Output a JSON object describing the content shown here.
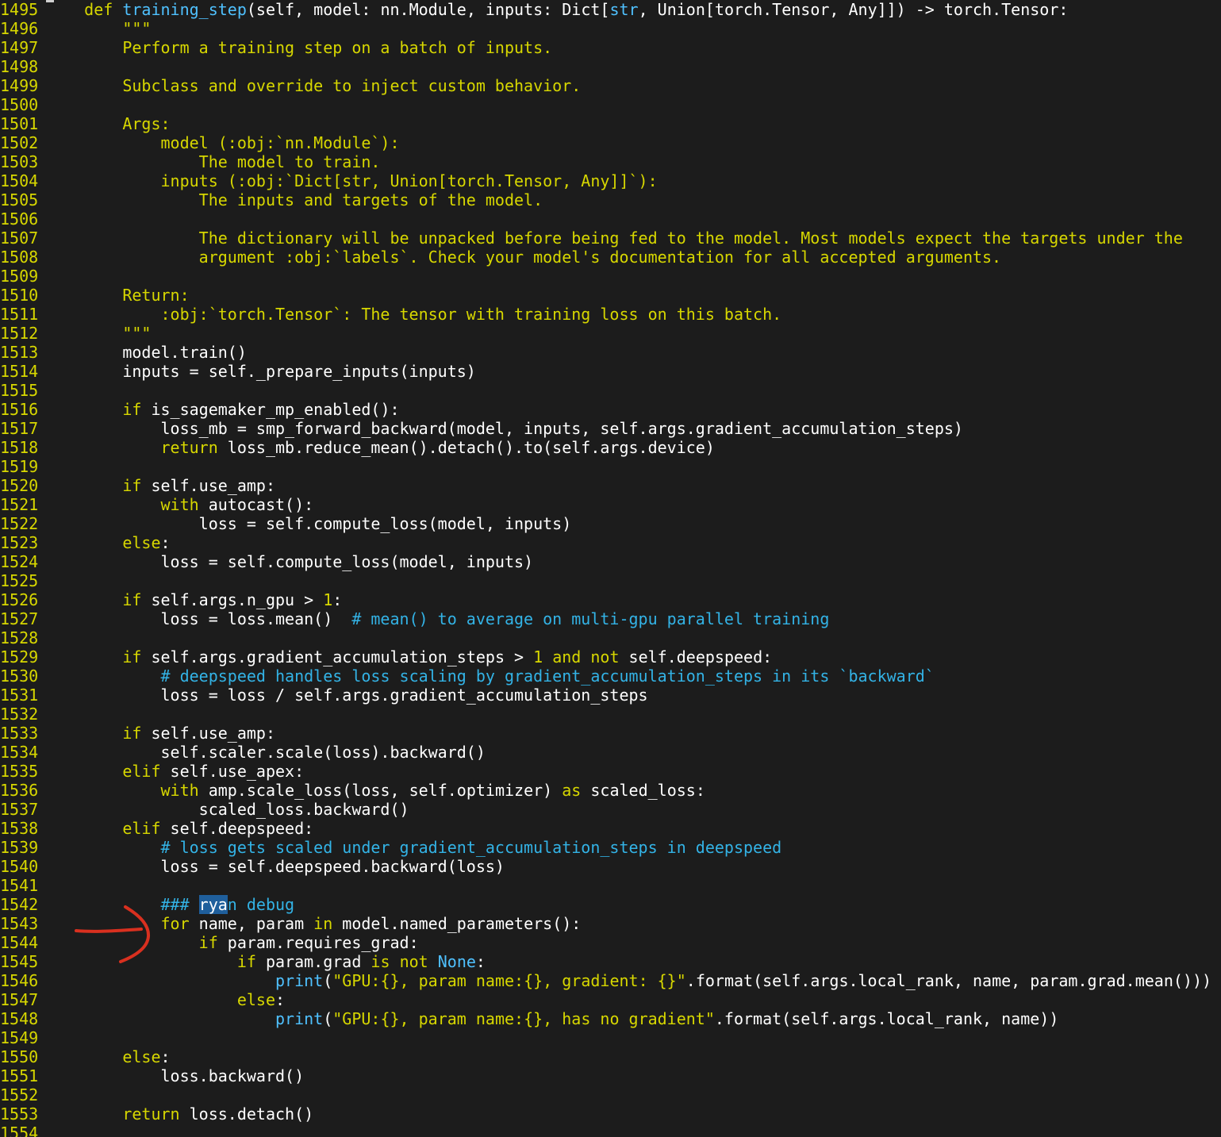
{
  "editor": {
    "lines": [
      {
        "n": "1495",
        "t": [
          [
            "    ",
            ""
          ],
          [
            "def",
            "kw"
          ],
          [
            " ",
            ""
          ],
          [
            "training_step",
            "fn"
          ],
          [
            "(self, model: nn.Module, inputs: Dict[",
            ""
          ],
          [
            "str",
            "bi"
          ],
          [
            ", Union[torch.Tensor, Any]]) -> torch.Tensor:",
            ""
          ]
        ]
      },
      {
        "n": "1496",
        "t": [
          [
            "        \"\"\"",
            "doc"
          ]
        ]
      },
      {
        "n": "1497",
        "t": [
          [
            "        Perform a training step on a batch of inputs.",
            "doc"
          ]
        ]
      },
      {
        "n": "1498",
        "t": [
          [
            "",
            ""
          ]
        ]
      },
      {
        "n": "1499",
        "t": [
          [
            "        Subclass and override to inject custom behavior.",
            "doc"
          ]
        ]
      },
      {
        "n": "1500",
        "t": [
          [
            "",
            ""
          ]
        ]
      },
      {
        "n": "1501",
        "t": [
          [
            "        Args:",
            "doc"
          ]
        ]
      },
      {
        "n": "1502",
        "t": [
          [
            "            model (:obj:`nn.Module`):",
            "doc"
          ]
        ]
      },
      {
        "n": "1503",
        "t": [
          [
            "                The model to train.",
            "doc"
          ]
        ]
      },
      {
        "n": "1504",
        "t": [
          [
            "            inputs (:obj:`Dict[str, Union[torch.Tensor, Any]]`):",
            "doc"
          ]
        ]
      },
      {
        "n": "1505",
        "t": [
          [
            "                The inputs and targets of the model.",
            "doc"
          ]
        ]
      },
      {
        "n": "1506",
        "t": [
          [
            "",
            ""
          ]
        ]
      },
      {
        "n": "1507",
        "t": [
          [
            "                The dictionary will be unpacked before being fed to the model. Most models expect the targets under the",
            "doc"
          ]
        ]
      },
      {
        "n": "1508",
        "t": [
          [
            "                argument :obj:`labels`. Check your model's documentation for all accepted arguments.",
            "doc"
          ]
        ]
      },
      {
        "n": "1509",
        "t": [
          [
            "",
            ""
          ]
        ]
      },
      {
        "n": "1510",
        "t": [
          [
            "        Return:",
            "doc"
          ]
        ]
      },
      {
        "n": "1511",
        "t": [
          [
            "            :obj:`torch.Tensor`: The tensor with training loss on this batch.",
            "doc"
          ]
        ]
      },
      {
        "n": "1512",
        "t": [
          [
            "        \"\"\"",
            "doc"
          ]
        ]
      },
      {
        "n": "1513",
        "t": [
          [
            "        model.train()",
            ""
          ]
        ]
      },
      {
        "n": "1514",
        "t": [
          [
            "        inputs = self._prepare_inputs(inputs)",
            ""
          ]
        ]
      },
      {
        "n": "1515",
        "t": [
          [
            "",
            ""
          ]
        ]
      },
      {
        "n": "1516",
        "t": [
          [
            "        ",
            ""
          ],
          [
            "if",
            "kw"
          ],
          [
            " is_sagemaker_mp_enabled():",
            ""
          ]
        ]
      },
      {
        "n": "1517",
        "t": [
          [
            "            loss_mb = smp_forward_backward(model, inputs, self.args.gradient_accumulation_steps)",
            ""
          ]
        ]
      },
      {
        "n": "1518",
        "t": [
          [
            "            ",
            ""
          ],
          [
            "return",
            "kw"
          ],
          [
            " loss_mb.reduce_mean().detach().to(self.args.device)",
            ""
          ]
        ]
      },
      {
        "n": "1519",
        "t": [
          [
            "",
            ""
          ]
        ]
      },
      {
        "n": "1520",
        "t": [
          [
            "        ",
            ""
          ],
          [
            "if",
            "kw"
          ],
          [
            " self.use_amp:",
            ""
          ]
        ]
      },
      {
        "n": "1521",
        "t": [
          [
            "            ",
            ""
          ],
          [
            "with",
            "kw"
          ],
          [
            " autocast():",
            ""
          ]
        ]
      },
      {
        "n": "1522",
        "t": [
          [
            "                loss = self.compute_loss(model, inputs)",
            ""
          ]
        ]
      },
      {
        "n": "1523",
        "t": [
          [
            "        ",
            ""
          ],
          [
            "else",
            "kw"
          ],
          [
            ":",
            ""
          ]
        ]
      },
      {
        "n": "1524",
        "t": [
          [
            "            loss = self.compute_loss(model, inputs)",
            ""
          ]
        ]
      },
      {
        "n": "1525",
        "t": [
          [
            "",
            ""
          ]
        ]
      },
      {
        "n": "1526",
        "t": [
          [
            "        ",
            ""
          ],
          [
            "if",
            "kw"
          ],
          [
            " self.args.n_gpu > ",
            ""
          ],
          [
            "1",
            "num"
          ],
          [
            ":",
            ""
          ]
        ]
      },
      {
        "n": "1527",
        "t": [
          [
            "            loss = loss.mean()  ",
            ""
          ],
          [
            "# mean() to average on multi-gpu parallel training",
            "cm"
          ]
        ]
      },
      {
        "n": "1528",
        "t": [
          [
            "",
            ""
          ]
        ]
      },
      {
        "n": "1529",
        "t": [
          [
            "        ",
            ""
          ],
          [
            "if",
            "kw"
          ],
          [
            " self.args.gradient_accumulation_steps > ",
            ""
          ],
          [
            "1",
            "num"
          ],
          [
            " ",
            ""
          ],
          [
            "and",
            "kw"
          ],
          [
            " ",
            ""
          ],
          [
            "not",
            "kw"
          ],
          [
            " self.deepspeed:",
            ""
          ]
        ]
      },
      {
        "n": "1530",
        "t": [
          [
            "            ",
            ""
          ],
          [
            "# deepspeed handles loss scaling by gradient_accumulation_steps in its `backward`",
            "cm"
          ]
        ]
      },
      {
        "n": "1531",
        "t": [
          [
            "            loss = loss / self.args.gradient_accumulation_steps",
            ""
          ]
        ]
      },
      {
        "n": "1532",
        "t": [
          [
            "",
            ""
          ]
        ]
      },
      {
        "n": "1533",
        "t": [
          [
            "        ",
            ""
          ],
          [
            "if",
            "kw"
          ],
          [
            " self.use_amp:",
            ""
          ]
        ]
      },
      {
        "n": "1534",
        "t": [
          [
            "            self.scaler.scale(loss).backward()",
            ""
          ]
        ]
      },
      {
        "n": "1535",
        "t": [
          [
            "        ",
            ""
          ],
          [
            "elif",
            "kw"
          ],
          [
            " self.use_apex:",
            ""
          ]
        ]
      },
      {
        "n": "1536",
        "t": [
          [
            "            ",
            ""
          ],
          [
            "with",
            "kw"
          ],
          [
            " amp.scale_loss(loss, self.optimizer) ",
            ""
          ],
          [
            "as",
            "kw"
          ],
          [
            " scaled_loss:",
            ""
          ]
        ]
      },
      {
        "n": "1537",
        "t": [
          [
            "                scaled_loss.backward()",
            ""
          ]
        ]
      },
      {
        "n": "1538",
        "t": [
          [
            "        ",
            ""
          ],
          [
            "elif",
            "kw"
          ],
          [
            " self.deepspeed:",
            ""
          ]
        ]
      },
      {
        "n": "1539",
        "t": [
          [
            "            ",
            ""
          ],
          [
            "# loss gets scaled under gradient_accumulation_steps in deepspeed",
            "cm"
          ]
        ]
      },
      {
        "n": "1540",
        "t": [
          [
            "            loss = self.deepspeed.backward(loss)",
            ""
          ]
        ]
      },
      {
        "n": "1541",
        "t": [
          [
            "",
            ""
          ]
        ]
      },
      {
        "n": "1542",
        "t": [
          [
            "            ",
            ""
          ],
          [
            "### ",
            "cm"
          ],
          [
            "rya",
            "hl"
          ],
          [
            "n debug",
            "cm"
          ]
        ]
      },
      {
        "n": "1543",
        "t": [
          [
            "            ",
            ""
          ],
          [
            "for",
            "kw"
          ],
          [
            " name, param ",
            ""
          ],
          [
            "in",
            "kw"
          ],
          [
            " model.named_parameters():",
            ""
          ]
        ]
      },
      {
        "n": "1544",
        "t": [
          [
            "                ",
            ""
          ],
          [
            "if",
            "kw"
          ],
          [
            " param.requires_grad:",
            ""
          ]
        ]
      },
      {
        "n": "1545",
        "t": [
          [
            "                    ",
            ""
          ],
          [
            "if",
            "kw"
          ],
          [
            " param.grad ",
            ""
          ],
          [
            "is",
            "kw"
          ],
          [
            " ",
            ""
          ],
          [
            "not",
            "kw"
          ],
          [
            " ",
            ""
          ],
          [
            "None",
            "bi"
          ],
          [
            ":",
            ""
          ]
        ]
      },
      {
        "n": "1546",
        "t": [
          [
            "                        ",
            ""
          ],
          [
            "print",
            "bi"
          ],
          [
            "(",
            ""
          ],
          [
            "\"GPU:{}, param name:{}, gradient: {}\"",
            "str"
          ],
          [
            ".format(self.args.local_rank, name, param.grad.mean()))",
            ""
          ]
        ]
      },
      {
        "n": "1547",
        "t": [
          [
            "                    ",
            ""
          ],
          [
            "else",
            "kw"
          ],
          [
            ":",
            ""
          ]
        ]
      },
      {
        "n": "1548",
        "t": [
          [
            "                        ",
            ""
          ],
          [
            "print",
            "bi"
          ],
          [
            "(",
            ""
          ],
          [
            "\"GPU:{}, param name:{}, has no gradient\"",
            "str"
          ],
          [
            ".format(self.args.local_rank, name))",
            ""
          ]
        ]
      },
      {
        "n": "1549",
        "t": [
          [
            "",
            ""
          ]
        ]
      },
      {
        "n": "1550",
        "t": [
          [
            "        ",
            ""
          ],
          [
            "else",
            "kw"
          ],
          [
            ":",
            ""
          ]
        ]
      },
      {
        "n": "1551",
        "t": [
          [
            "            loss.backward()",
            ""
          ]
        ]
      },
      {
        "n": "1552",
        "t": [
          [
            "",
            ""
          ]
        ]
      },
      {
        "n": "1553",
        "t": [
          [
            "        ",
            ""
          ],
          [
            "return",
            "kw"
          ],
          [
            " loss.detach()",
            ""
          ]
        ]
      },
      {
        "n": "1554",
        "t": [
          [
            "",
            ""
          ]
        ]
      }
    ]
  },
  "annotation": {
    "color": "#d9301f",
    "icon": "hand-drawn-arrow-icon"
  },
  "colors": {
    "background": "#1c1c1c",
    "line_number": "#d7d700",
    "keyword": "#d7d700",
    "function_name": "#4fc1ff",
    "docstring": "#d7d700",
    "comment": "#33b3e6",
    "search_highlight": "#1f5f9c",
    "text": "#ffffff"
  }
}
